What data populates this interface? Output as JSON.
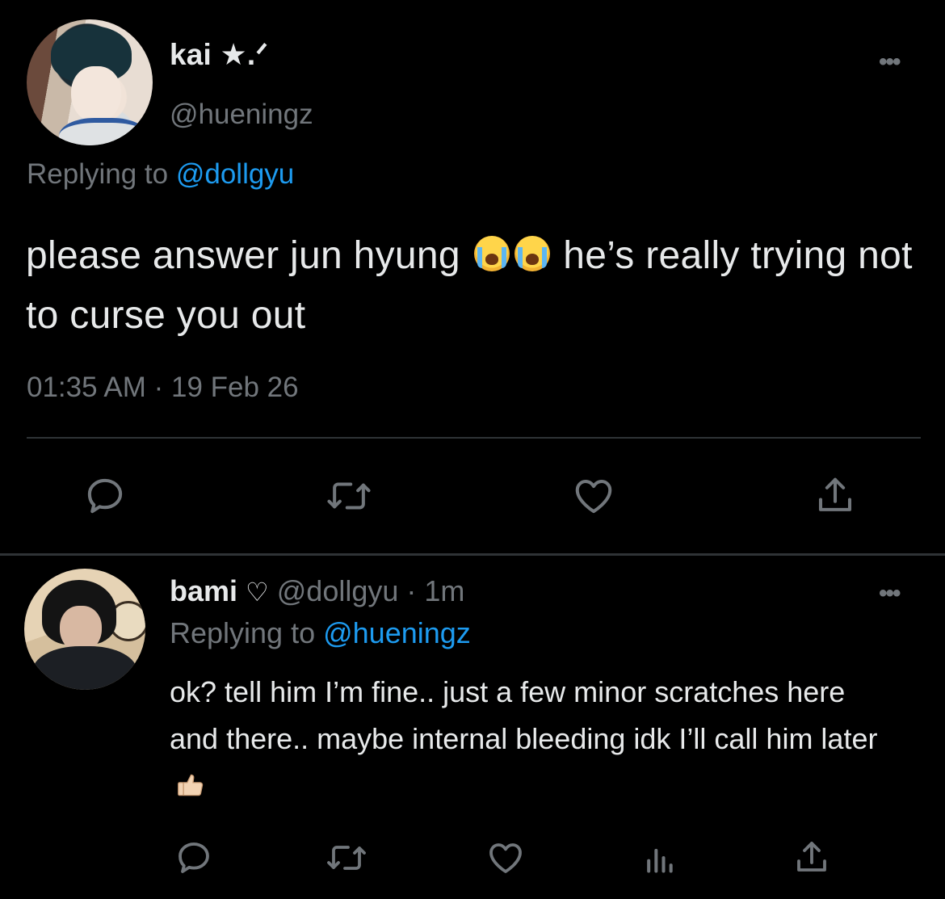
{
  "main_tweet": {
    "display_name": "kai ★.ᐟ",
    "handle": "@hueningz",
    "replying_prefix": "Replying to ",
    "replying_handle": "@dollgyu",
    "text_part1": "please answer jun hyung ",
    "text_part2": " he’s really trying not to curse you out",
    "timestamp": "01:35 AM · 19 Feb 26",
    "more": "•••",
    "actions": [
      "reply-icon",
      "retweet-icon",
      "like-icon",
      "share-icon"
    ]
  },
  "reply_tweet": {
    "display_name": "bami",
    "heart": "♡",
    "meta": "@dollgyu · 1m",
    "replying_prefix": "Replying to ",
    "replying_handle": "@hueningz",
    "text": "ok? tell him I’m fine.. just a few minor scratches here and there.. maybe internal bleeding idk I’ll call him later",
    "more": "•••",
    "actions": [
      "reply-icon",
      "retweet-icon",
      "like-icon",
      "analytics-icon",
      "share-icon"
    ]
  },
  "colors": {
    "background": "#000000",
    "text": "#e7e9ea",
    "secondary": "#71767b",
    "link": "#1d9bf0",
    "divider": "#2f3336"
  }
}
